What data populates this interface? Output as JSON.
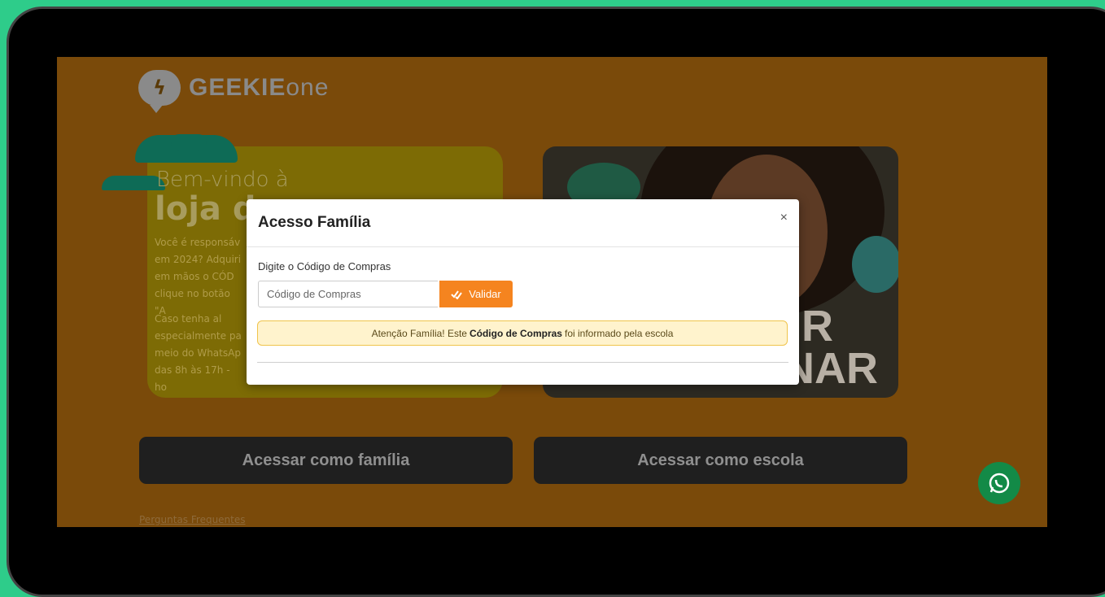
{
  "brand": {
    "logo_icon": "lightning-bolt-icon",
    "name_bold": "GEEKIE",
    "name_light": "one"
  },
  "hero": {
    "welcome": "Bem-vindo à",
    "title": "loja d",
    "p1_lines": [
      "Você é responsáv",
      "em 2024? Adquiri",
      "em mãos o CÓD",
      "clique no botão \"A"
    ],
    "p2_lines": [
      "Caso tenha al",
      "especialmente pa",
      "meio do WhatsAp",
      "das 8h às 17h - ho"
    ]
  },
  "image_card": {
    "text_line1": "R",
    "text_line2": "NAR"
  },
  "buttons": {
    "family": "Acessar como família",
    "school": "Acessar como escola"
  },
  "footer": {
    "faq_link": "Perguntas Frequentes"
  },
  "modal": {
    "title": "Acesso Família",
    "close_label": "×",
    "field_label": "Digite o Código de Compras",
    "input_placeholder": "Código de Compras",
    "input_value": "",
    "validate_label": "Validar",
    "validate_icon": "double-check-icon",
    "alert_prefix": "Atenção Família! Este",
    "alert_bold": "Código de Compras",
    "alert_suffix": "foi informado pela escola"
  },
  "whatsapp": {
    "icon": "whatsapp-icon"
  },
  "colors": {
    "accent_orange": "#f5841f",
    "alert_bg": "#fff3cd",
    "backdrop_green": "#2ecc8a"
  }
}
